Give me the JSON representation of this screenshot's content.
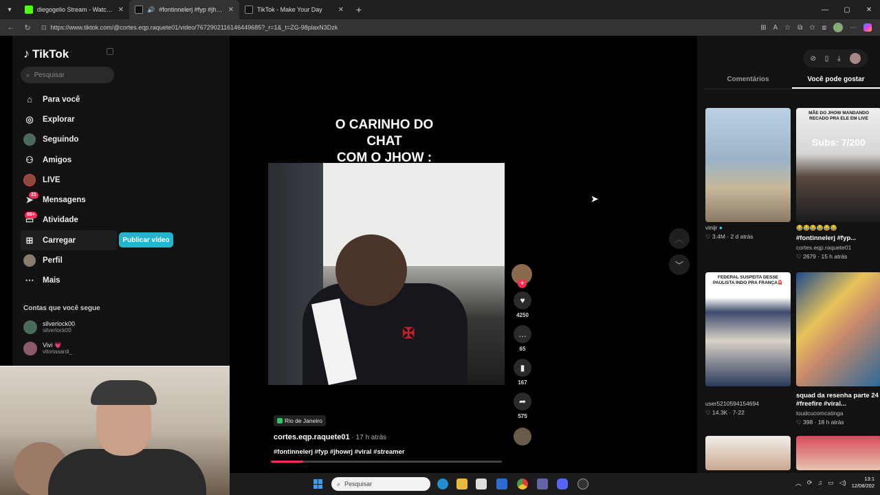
{
  "browser": {
    "tabs": [
      {
        "title": "diegogelio Stream - Watch Live o",
        "favicon_color": "#53fc18"
      },
      {
        "title": "#fontinnelerj #fyp #jhowrj #v",
        "favicon_color": "#111111"
      },
      {
        "title": "TikTok - Make Your Day",
        "favicon_color": "#111111"
      }
    ],
    "url": "https://www.tiktok.com/@cortes.eqp.raquete01/video/7672902116146449685?_r=1&_t=ZG-98plaxN3Dzk"
  },
  "sidebar": {
    "logo": "TikTok",
    "search_placeholder": "Pesquisar",
    "nav": [
      {
        "label": "Para você",
        "icon": "home-icon"
      },
      {
        "label": "Explorar",
        "icon": "compass-icon"
      },
      {
        "label": "Seguindo",
        "icon": "following-avatar-icon"
      },
      {
        "label": "Amigos",
        "icon": "friends-icon"
      },
      {
        "label": "LIVE",
        "icon": "live-icon"
      },
      {
        "label": "Mensagens",
        "icon": "send-icon",
        "badge": "21"
      },
      {
        "label": "Atividade",
        "icon": "inbox-icon",
        "badge": "99+"
      },
      {
        "label": "Carregar",
        "icon": "upload-icon"
      },
      {
        "label": "Perfil",
        "icon": "profile-avatar-icon"
      },
      {
        "label": "Mais",
        "icon": "more-icon"
      }
    ],
    "publish_button": "Publicar vídeo",
    "following_heading": "Contas que você segue",
    "following": [
      {
        "name": "silverlock00",
        "handle": "silverlock00"
      },
      {
        "name": "Vivi 💗",
        "handle": "vitoriasardi_"
      }
    ]
  },
  "video": {
    "caption_line1": "O CARINHO DO CHAT",
    "caption_line2": "COM O JHOW :",
    "location": "Rio de Janeiro",
    "author": "cortes.eqp.raquete01",
    "posted": " · 17 h atrás",
    "tags": "#fontinnelerj #fyp #jhowrj #viral #streamer",
    "progress": 0.14,
    "likes": "4250",
    "comments": "65",
    "saves": "167",
    "shares": "575"
  },
  "right_panel": {
    "tabs": [
      "Comentários",
      "Você pode gostar"
    ],
    "active_tab": 1,
    "cards": [
      {
        "overlay": "",
        "top_text": "",
        "title": "",
        "author": "vinijr",
        "verified": true,
        "views": "3.4M",
        "age": "2 d atrás"
      },
      {
        "overlay": "Subs: 7/200",
        "top_text": "MÃE DO JHOW MANDANDO RECADO PRA ELE EM LIVE",
        "emojis": "😂😂😂😂😂😂",
        "title": "#fontinnelerj #fyp...",
        "author": "cortes.eqp.raquete01",
        "views": "2679",
        "age": "15 h atrás"
      },
      {
        "overlay": "",
        "top_text": "FEDERAL SUSPEITA DESSE PAULISTA INDO PRA FRANÇA🚨",
        "title": "",
        "author": "user5210594154694",
        "views": "14.3K",
        "age": "7-22"
      },
      {
        "overlay": "",
        "top_text": "",
        "title": "squad da resenha parte 24 #freefire #viral...",
        "author": "loudcucomcatinga",
        "views": "398",
        "age": "18 h atrás"
      }
    ]
  },
  "taskbar": {
    "search_placeholder": "Pesquisar",
    "time": "13:1",
    "date": "12/08/202"
  }
}
